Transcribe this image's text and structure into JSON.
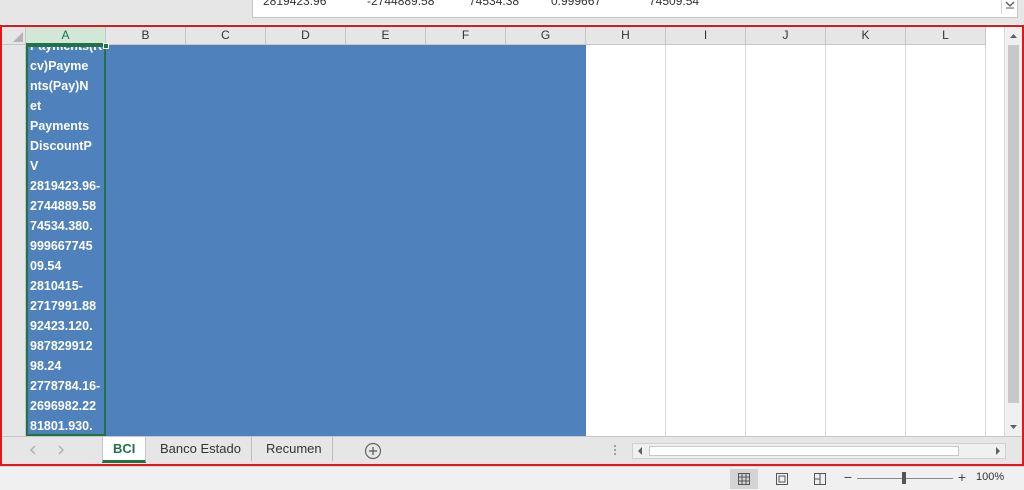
{
  "formula_bar": {
    "values": [
      "2819423.96",
      "-2744889.58",
      "74534.38",
      "0.999667",
      "74509.54"
    ]
  },
  "columns": [
    "A",
    "B",
    "C",
    "D",
    "E",
    "F",
    "G",
    "H",
    "I",
    "J",
    "K",
    "L"
  ],
  "selected_column": "A",
  "cell_a_lines": [
    "Payments(Re",
    "cv)Payme",
    "nts(Pay)N",
    "et",
    "Payments",
    "DiscountP",
    "V",
    "2819423.96-",
    "2744889.58",
    "74534.380.",
    "999667745",
    "09.54",
    "2810415-",
    "2717991.88",
    "92423.120.",
    "987829912",
    "98.24",
    "2778784.16-",
    "2696982.22",
    "81801.930."
  ],
  "sheet_tabs": [
    {
      "label": "BCI",
      "active": true
    },
    {
      "label": "Banco Estado",
      "active": false
    },
    {
      "label": "Recumen",
      "active": false
    }
  ],
  "status_bar": {
    "zoom_label": "100%",
    "zoom_fraction": 0.48
  },
  "colors": {
    "fill_blue": "#4f81bd",
    "excel_green": "#217346",
    "frame_red": "#e8141c"
  },
  "icons": [
    "add-sheet-icon",
    "normal-view-icon",
    "page-layout-view-icon",
    "page-break-view-icon",
    "scroll-left-icon",
    "scroll-right-icon",
    "scroll-up-icon",
    "scroll-down-icon",
    "select-all-triangle-icon"
  ]
}
